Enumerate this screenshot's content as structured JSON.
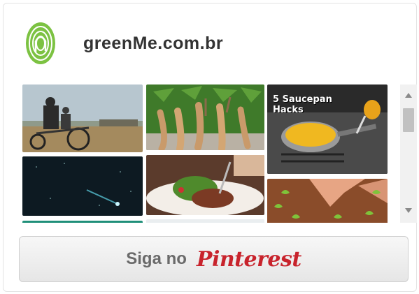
{
  "header": {
    "site_name": "greenMe.com.br",
    "logo_icon": "greenme-fingerprint-logo-icon"
  },
  "pins": [
    {
      "name": "pin-rickshaw-children",
      "icon": "photo-children-on-cart"
    },
    {
      "name": "pin-cassava-roots",
      "icon": "photo-cassava-roots"
    },
    {
      "name": "pin-saucepan-hacks",
      "icon": "photo-saucepan",
      "caption": "5 Saucepan Hacks"
    },
    {
      "name": "pin-comet-night-sky",
      "icon": "photo-comet"
    },
    {
      "name": "pin-steak-salad",
      "icon": "photo-steak-salad"
    },
    {
      "name": "pin-seedling-garden",
      "icon": "photo-seedlings"
    }
  ],
  "follow_button": {
    "label": "Siga no",
    "brand": "Pinterest"
  },
  "colors": {
    "brand_red": "#c8232c",
    "logo_green": "#7cc242",
    "text_dark": "#333333",
    "button_text": "#6a6a6a"
  }
}
